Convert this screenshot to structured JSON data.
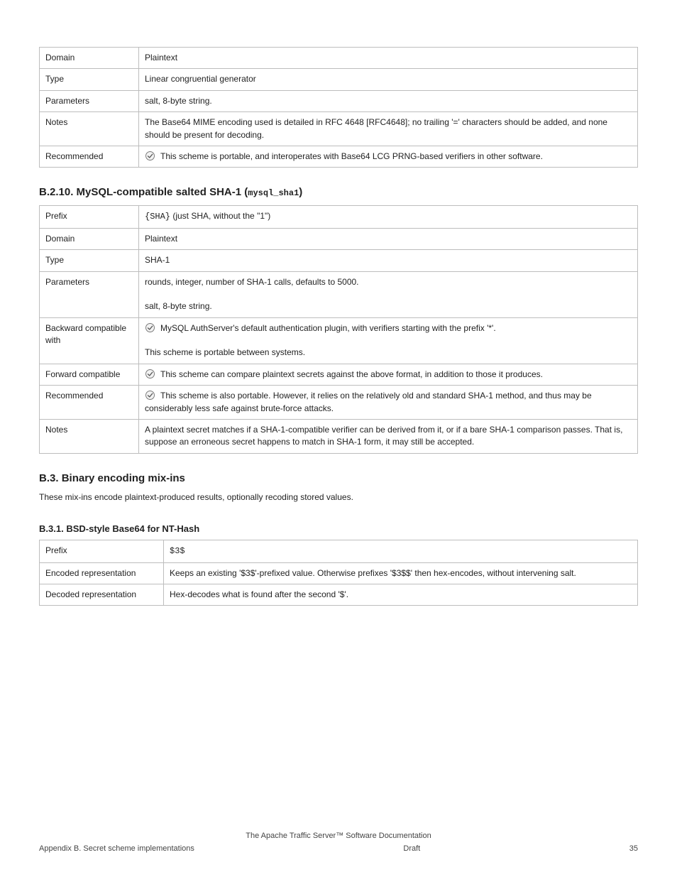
{
  "table1": {
    "rows": [
      {
        "label": "Domain",
        "value": "Plaintext"
      },
      {
        "label": "Type",
        "value": "Linear congruential generator"
      },
      {
        "label": "Parameters",
        "value": "salt, 8-byte string."
      },
      {
        "label": "Notes",
        "value": "The Base64 MIME encoding used is detailed in RFC 4648 [RFC4648]; no trailing '=' characters should be added, and none should be present for decoding."
      },
      {
        "label": "Recommended",
        "value_after_icon": "This scheme is portable, and interoperates with Base64 LCG PRNG-based verifiers in other software."
      }
    ]
  },
  "section_mysql": {
    "id": "B.2.10.",
    "title": "MySQL-compatible salted SHA-1",
    "anchor": "mysql_sha1"
  },
  "table2": {
    "rows": [
      {
        "label": "Prefix",
        "value_code": "{SHA}",
        "value_after_code": " (just SHA, without the \"1\")"
      },
      {
        "label": "Domain",
        "value": "Plaintext"
      },
      {
        "label": "Type",
        "value": "SHA-1"
      },
      {
        "label": "Parameters",
        "value": "rounds, integer, number of SHA-1 calls, defaults to 5000.\n\nsalt, 8-byte string."
      },
      {
        "label": "Backward compatible with",
        "value_after_icon": "MySQL AuthServer's default authentication plugin, with verifiers starting with the prefix '*'.\n\nThis scheme is portable between systems."
      },
      {
        "label": "Forward compatible",
        "value_after_icon": "This scheme can compare plaintext secrets against the above format, in addition to those it produces."
      },
      {
        "label": "Recommended",
        "value_after_icon": "This scheme is also portable. However, it relies on the relatively old and standard SHA-1 method, and thus may be considerably less safe against brute-force attacks."
      },
      {
        "label": "Notes",
        "value": "A plaintext secret matches if a SHA-1-compatible verifier can be derived from it, or if a bare SHA-1 comparison passes. That is, suppose an erroneous secret happens to match in SHA-1 form, it may still be accepted."
      }
    ]
  },
  "section_b3": {
    "id": "B.3.",
    "title": "Binary encoding mix-ins"
  },
  "b3_para1": "These mix-ins encode plaintext-produced results, optionally recoding stored values.",
  "section_b31": {
    "id": "B.3.1.",
    "title": "BSD-style Base64 for NT-Hash"
  },
  "table3": {
    "rows": [
      {
        "label": "Prefix",
        "value_code": "$3$"
      },
      {
        "label": "Encoded representation",
        "value": "Keeps an existing '$3$'-prefixed value. Otherwise prefixes '$3$$' then hex-encodes, without intervening salt."
      },
      {
        "label": "Decoded representation",
        "value": "Hex-decodes what is found after the second '$'."
      }
    ]
  },
  "footer": {
    "title": "The Apache Traffic Server™ Software Documentation",
    "left": "Appendix B. Secret scheme implementations",
    "center": "Draft",
    "right": "35"
  }
}
